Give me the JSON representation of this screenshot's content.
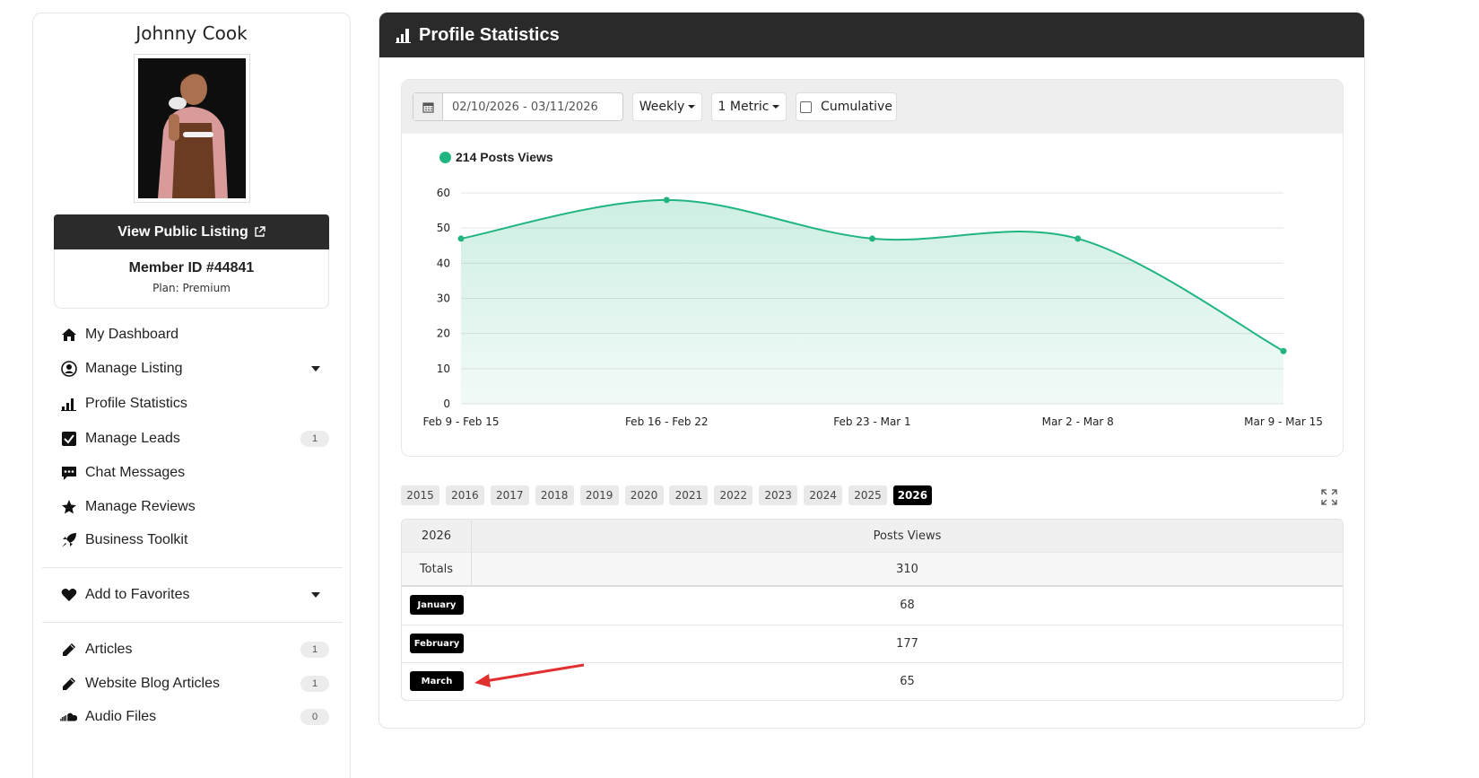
{
  "profile": {
    "name": "Johnny Cook",
    "view_public_label": "View Public Listing",
    "member_id": "Member ID #44841",
    "plan": "Plan: Premium"
  },
  "sidebar": {
    "items": [
      {
        "label": "My Dashboard",
        "icon": "home-icon"
      },
      {
        "label": "Manage Listing",
        "icon": "user-circle-icon",
        "dropdown": true
      },
      {
        "label": "Profile Statistics",
        "icon": "bar-chart-icon"
      },
      {
        "label": "Manage Leads",
        "icon": "checkbox-icon",
        "badge": "1"
      },
      {
        "label": "Chat Messages",
        "icon": "chat-icon"
      },
      {
        "label": "Manage Reviews",
        "icon": "star-icon"
      },
      {
        "label": "Business Toolkit",
        "icon": "rocket-icon"
      },
      {
        "label": "Add to Favorites",
        "icon": "heart-icon",
        "dropdown": true
      },
      {
        "label": "Articles",
        "icon": "pencil-icon",
        "badge": "1"
      },
      {
        "label": "Website Blog Articles",
        "icon": "pencil-icon",
        "badge": "1"
      },
      {
        "label": "Audio Files",
        "icon": "soundcloud-icon",
        "badge": "0"
      }
    ]
  },
  "panel": {
    "title": "Profile Statistics"
  },
  "toolbar": {
    "date_range": "02/10/2026 - 03/11/2026",
    "interval": "Weekly",
    "metric": "1 Metric",
    "cumulative_label": "Cumulative"
  },
  "chart_data": {
    "type": "area",
    "legend": "214 Posts Views",
    "categories": [
      "Feb 9 - Feb 15",
      "Feb 16 - Feb 22",
      "Feb 23 - Mar 1",
      "Mar 2 - Mar 8",
      "Mar 9 - Mar 15"
    ],
    "series": [
      {
        "name": "Posts Views",
        "values": [
          47,
          58,
          47,
          47,
          15
        ]
      }
    ],
    "ylim": [
      0,
      60
    ],
    "yticks": [
      0,
      10,
      20,
      30,
      40,
      50,
      60
    ],
    "color": "#20b57f",
    "grid": true
  },
  "years": {
    "items": [
      "2015",
      "2016",
      "2017",
      "2018",
      "2019",
      "2020",
      "2021",
      "2022",
      "2023",
      "2024",
      "2025",
      "2026"
    ],
    "active": "2026"
  },
  "table": {
    "year_header": "2026",
    "metric_header": "Posts Views",
    "totals_label": "Totals",
    "totals_value": "310",
    "rows": [
      {
        "month": "January",
        "value": "68"
      },
      {
        "month": "February",
        "value": "177"
      },
      {
        "month": "March",
        "value": "65"
      }
    ]
  },
  "colors": {
    "accent": "#20b57f",
    "header_bg": "#2a2a2a",
    "annotation_arrow": "#e03030"
  }
}
